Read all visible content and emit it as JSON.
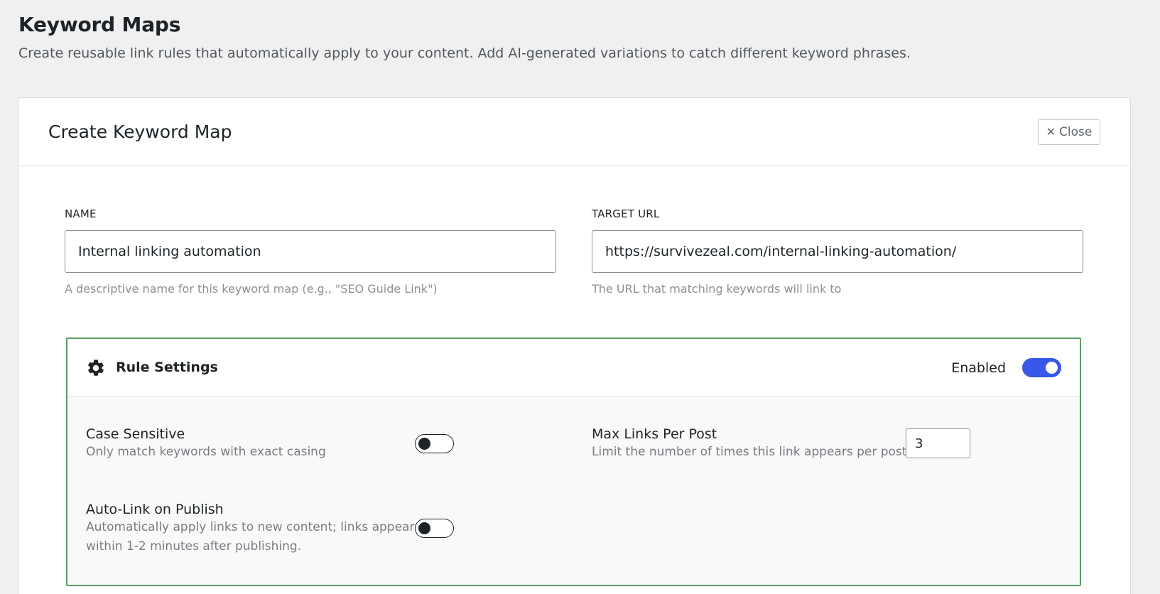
{
  "page": {
    "title": "Keyword Maps",
    "description": "Create reusable link rules that automatically apply to your content. Add AI-generated variations to catch different keyword phrases."
  },
  "card": {
    "title": "Create Keyword Map",
    "close_icon": "close-x-icon",
    "close_label": "Close"
  },
  "form": {
    "name": {
      "label": "NAME",
      "value": "Internal linking automation",
      "hint": "A descriptive name for this keyword map (e.g., \"SEO Guide Link\")"
    },
    "target_url": {
      "label": "TARGET URL",
      "value": "https://survivezeal.com/internal-linking-automation/",
      "hint": "The URL that matching keywords will link to"
    }
  },
  "rule_settings": {
    "icon": "gear-icon",
    "title": "Rule Settings",
    "enabled_label": "Enabled",
    "enabled": true,
    "case_sensitive": {
      "title": "Case Sensitive",
      "description": "Only match keywords with exact casing",
      "on": false
    },
    "max_links": {
      "title": "Max Links Per Post",
      "description": "Limit the number of times this link appears per post",
      "value": "3"
    },
    "auto_link": {
      "title": "Auto-Link on Publish",
      "description_line1": "Automatically apply links to new content; links appear",
      "description_line2": "within 1-2 minutes after publishing.",
      "on": false
    }
  },
  "colors": {
    "accent": "#3858e9",
    "rules_border": "#5a9e63"
  }
}
